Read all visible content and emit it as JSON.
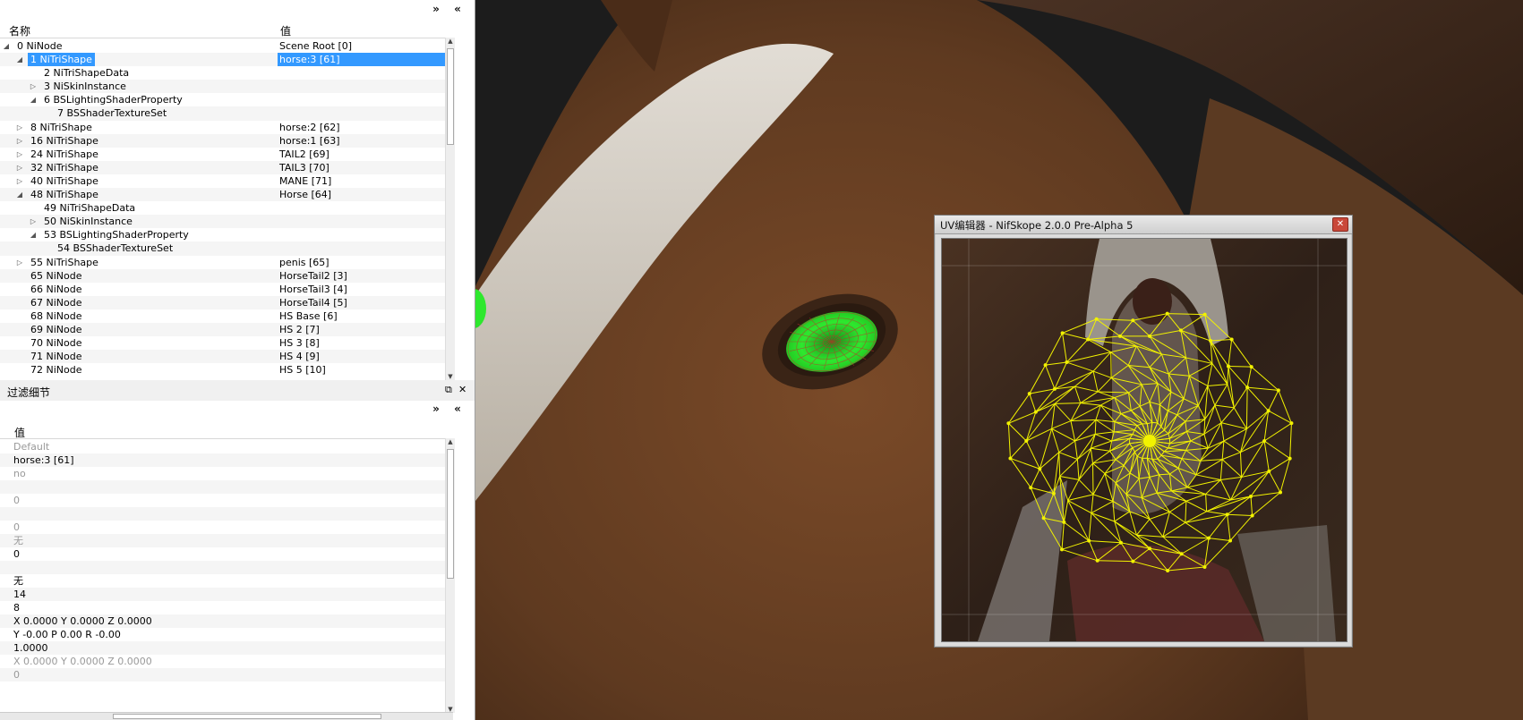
{
  "tree": {
    "header": {
      "name_col": "名称",
      "value_col": "值"
    },
    "dock_buttons": [
      "»",
      "«"
    ],
    "rows": [
      {
        "name": "0 NiNode",
        "value": "Scene Root [0]",
        "level": 0,
        "arrow": "open"
      },
      {
        "name": "1 NiTriShape",
        "value": "horse:3 [61]",
        "level": 1,
        "arrow": "open",
        "selected": true
      },
      {
        "name": "2 NiTriShapeData",
        "value": "",
        "level": 2,
        "arrow": ""
      },
      {
        "name": "3 NiSkinInstance",
        "value": "",
        "level": 2,
        "arrow": "closed"
      },
      {
        "name": "6 BSLightingShaderProperty",
        "value": "",
        "level": 2,
        "arrow": "open"
      },
      {
        "name": "7 BSShaderTextureSet",
        "value": "",
        "level": 3,
        "arrow": ""
      },
      {
        "name": "8 NiTriShape",
        "value": "horse:2 [62]",
        "level": 1,
        "arrow": "closed"
      },
      {
        "name": "16 NiTriShape",
        "value": "horse:1 [63]",
        "level": 1,
        "arrow": "closed"
      },
      {
        "name": "24 NiTriShape",
        "value": "TAIL2 [69]",
        "level": 1,
        "arrow": "closed"
      },
      {
        "name": "32 NiTriShape",
        "value": "TAIL3 [70]",
        "level": 1,
        "arrow": "closed"
      },
      {
        "name": "40 NiTriShape",
        "value": "MANE [71]",
        "level": 1,
        "arrow": "closed"
      },
      {
        "name": "48 NiTriShape",
        "value": "Horse [64]",
        "level": 1,
        "arrow": "open"
      },
      {
        "name": "49 NiTriShapeData",
        "value": "",
        "level": 2,
        "arrow": ""
      },
      {
        "name": "50 NiSkinInstance",
        "value": "",
        "level": 2,
        "arrow": "closed"
      },
      {
        "name": "53 BSLightingShaderProperty",
        "value": "",
        "level": 2,
        "arrow": "open"
      },
      {
        "name": "54 BSShaderTextureSet",
        "value": "",
        "level": 3,
        "arrow": ""
      },
      {
        "name": "55 NiTriShape",
        "value": "penis [65]",
        "level": 1,
        "arrow": "closed"
      },
      {
        "name": "65 NiNode",
        "value": "HorseTail2 [3]",
        "level": 1,
        "arrow": ""
      },
      {
        "name": "66 NiNode",
        "value": "HorseTail3 [4]",
        "level": 1,
        "arrow": ""
      },
      {
        "name": "67 NiNode",
        "value": "HorseTail4 [5]",
        "level": 1,
        "arrow": ""
      },
      {
        "name": "68 NiNode",
        "value": "HS Base [6]",
        "level": 1,
        "arrow": ""
      },
      {
        "name": "69 NiNode",
        "value": "HS 2 [7]",
        "level": 1,
        "arrow": ""
      },
      {
        "name": "70 NiNode",
        "value": "HS 3 [8]",
        "level": 1,
        "arrow": ""
      },
      {
        "name": "71 NiNode",
        "value": "HS 4 [9]",
        "level": 1,
        "arrow": ""
      },
      {
        "name": "72 NiNode",
        "value": "HS 5 [10]",
        "level": 1,
        "arrow": ""
      }
    ]
  },
  "details": {
    "title": "过滤细节",
    "title_buttons": [
      "⧉",
      "✕"
    ],
    "header": {
      "value_col": "值"
    },
    "dock_buttons": [
      "»",
      "«"
    ],
    "rows": [
      {
        "text": "Default",
        "gray": true
      },
      {
        "text": "horse:3 [61]",
        "gray": false
      },
      {
        "text": "no",
        "gray": true
      },
      {
        "text": "",
        "gray": false
      },
      {
        "text": "0",
        "gray": true
      },
      {
        "text": "",
        "gray": false
      },
      {
        "text": "0",
        "gray": true
      },
      {
        "text": "无",
        "gray": true
      },
      {
        "text": "0",
        "gray": false
      },
      {
        "text": "",
        "gray": false
      },
      {
        "text": "无",
        "gray": false
      },
      {
        "text": "14",
        "gray": false
      },
      {
        "text": "8",
        "gray": false
      },
      {
        "text": "X 0.0000 Y 0.0000 Z 0.0000",
        "gray": false
      },
      {
        "text": "Y -0.00 P 0.00 R -0.00",
        "gray": false
      },
      {
        "text": "1.0000",
        "gray": false
      },
      {
        "text": "X 0.0000 Y 0.0000 Z 0.0000",
        "gray": true
      },
      {
        "text": "0",
        "gray": true
      }
    ]
  },
  "uv_editor": {
    "title": "UV编辑器 - NifSkope 2.0.0 Pre-Alpha 5",
    "close_glyph": "✕",
    "wire_color": "#f2f200"
  },
  "viewport": {
    "eye_highlight_color": "#2ee82e",
    "coat_color": "#6b3f22",
    "blaze_color": "#d9d4cc"
  }
}
